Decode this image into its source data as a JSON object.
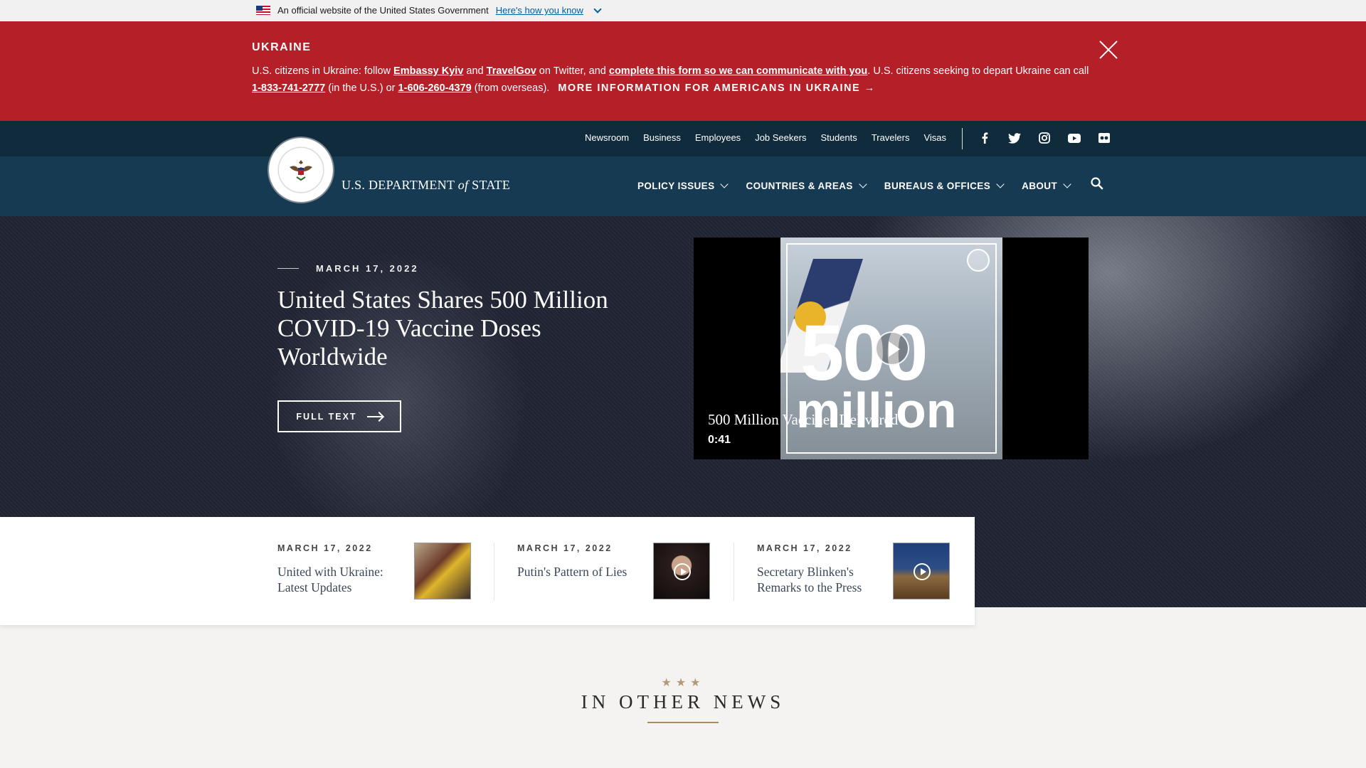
{
  "gov_banner": {
    "text": "An official website of the United States Government",
    "link": "Here's how you know"
  },
  "alert": {
    "title": "UKRAINE",
    "part1": "U.S. citizens in Ukraine: follow ",
    "link1": "Embassy Kyiv",
    "part2": " and ",
    "link2": "TravelGov",
    "part3": " on Twitter, and ",
    "link3": "complete this form so we can communicate with you",
    "part4": ". U.S. citizens seeking to depart Ukraine can call ",
    "phone1": "1-833-741-2777",
    "part5": " (in the U.S.) or ",
    "phone2": "1-606-260-4379",
    "part6": " (from overseas).",
    "more": "MORE INFORMATION FOR AMERICANS IN UKRAINE →"
  },
  "utility_nav": [
    "Newsroom",
    "Business",
    "Employees",
    "Job Seekers",
    "Students",
    "Travelers",
    "Visas"
  ],
  "brand": {
    "pre": "U.S. DEPARTMENT ",
    "of": "of",
    "post": " STATE"
  },
  "main_nav": [
    "POLICY ISSUES",
    "COUNTRIES & AREAS",
    "BUREAUS & OFFICES",
    "ABOUT"
  ],
  "hero": {
    "date": "MARCH 17, 2022",
    "headline": "United States Shares 500 Million COVID-19 Vaccine Doses Worldwide",
    "button": "FULL TEXT",
    "video": {
      "big": "500",
      "small": "million",
      "caption": "500 Million Vaccines Delivered",
      "duration": "0:41"
    }
  },
  "cards": [
    {
      "date": "MARCH 17, 2022",
      "title": "United with Ukraine: Latest Updates"
    },
    {
      "date": "MARCH 17, 2022",
      "title": "Putin's Pattern of Lies"
    },
    {
      "date": "MARCH 17, 2022",
      "title": "Secretary Blinken's Remarks to the Press"
    }
  ],
  "other_news": {
    "stars": "★★★",
    "title": "IN OTHER NEWS"
  },
  "colors": {
    "alert_red": "#b41f28",
    "util_navy": "#102b3c",
    "nav_blue": "#173a53",
    "gold": "#b08a5b"
  }
}
